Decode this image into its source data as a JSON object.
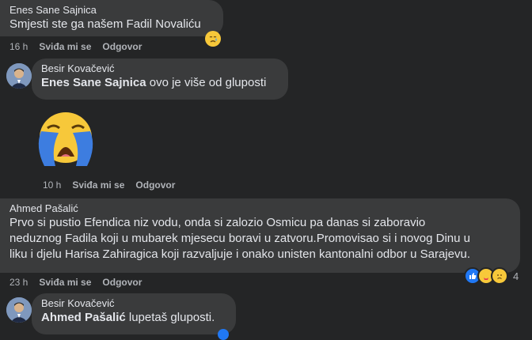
{
  "comments": [
    {
      "author": "Enes Sane Sajnica",
      "text": "Smjesti ste ga našem Fadil Novaliću",
      "time": "16 h",
      "like_label": "Sviđa mi se",
      "reply_label": "Odgovor"
    },
    {
      "author": "Besir Kovačević",
      "mention": "Enes Sane Sajnica",
      "text": " ovo je više od gluposti",
      "time": "10 h",
      "like_label": "Sviđa mi se",
      "reply_label": "Odgovor",
      "sticker": "loudly-crying-face"
    },
    {
      "author": "Ahmed Pašalić",
      "lines": [
        "Prvo si pustio Efendica niz vodu, onda si zalozio Osmicu pa danas si zaboravio",
        "neduznog Fadila koji u mubarek mjesecu boravi u zatvoru.Promovisao si i novog Dinu u",
        "liku i djelu Harisa Zahiragica koji razvaljuje i onako unisten kantonalni odbor u Sarajevu."
      ],
      "time": "23 h",
      "like_label": "Sviđa mi se",
      "reply_label": "Odgovor",
      "reaction_count": "4",
      "reactions": [
        "like",
        "care",
        "sad"
      ]
    },
    {
      "author": "Besir Kovačević",
      "mention": "Ahmed Pašalić",
      "text": " lupetaš gluposti."
    }
  ],
  "colors": {
    "background": "#242526",
    "bubble": "#3a3b3c",
    "like_blue": "#2078f4",
    "emoji_yellow": "#f7c83a"
  }
}
